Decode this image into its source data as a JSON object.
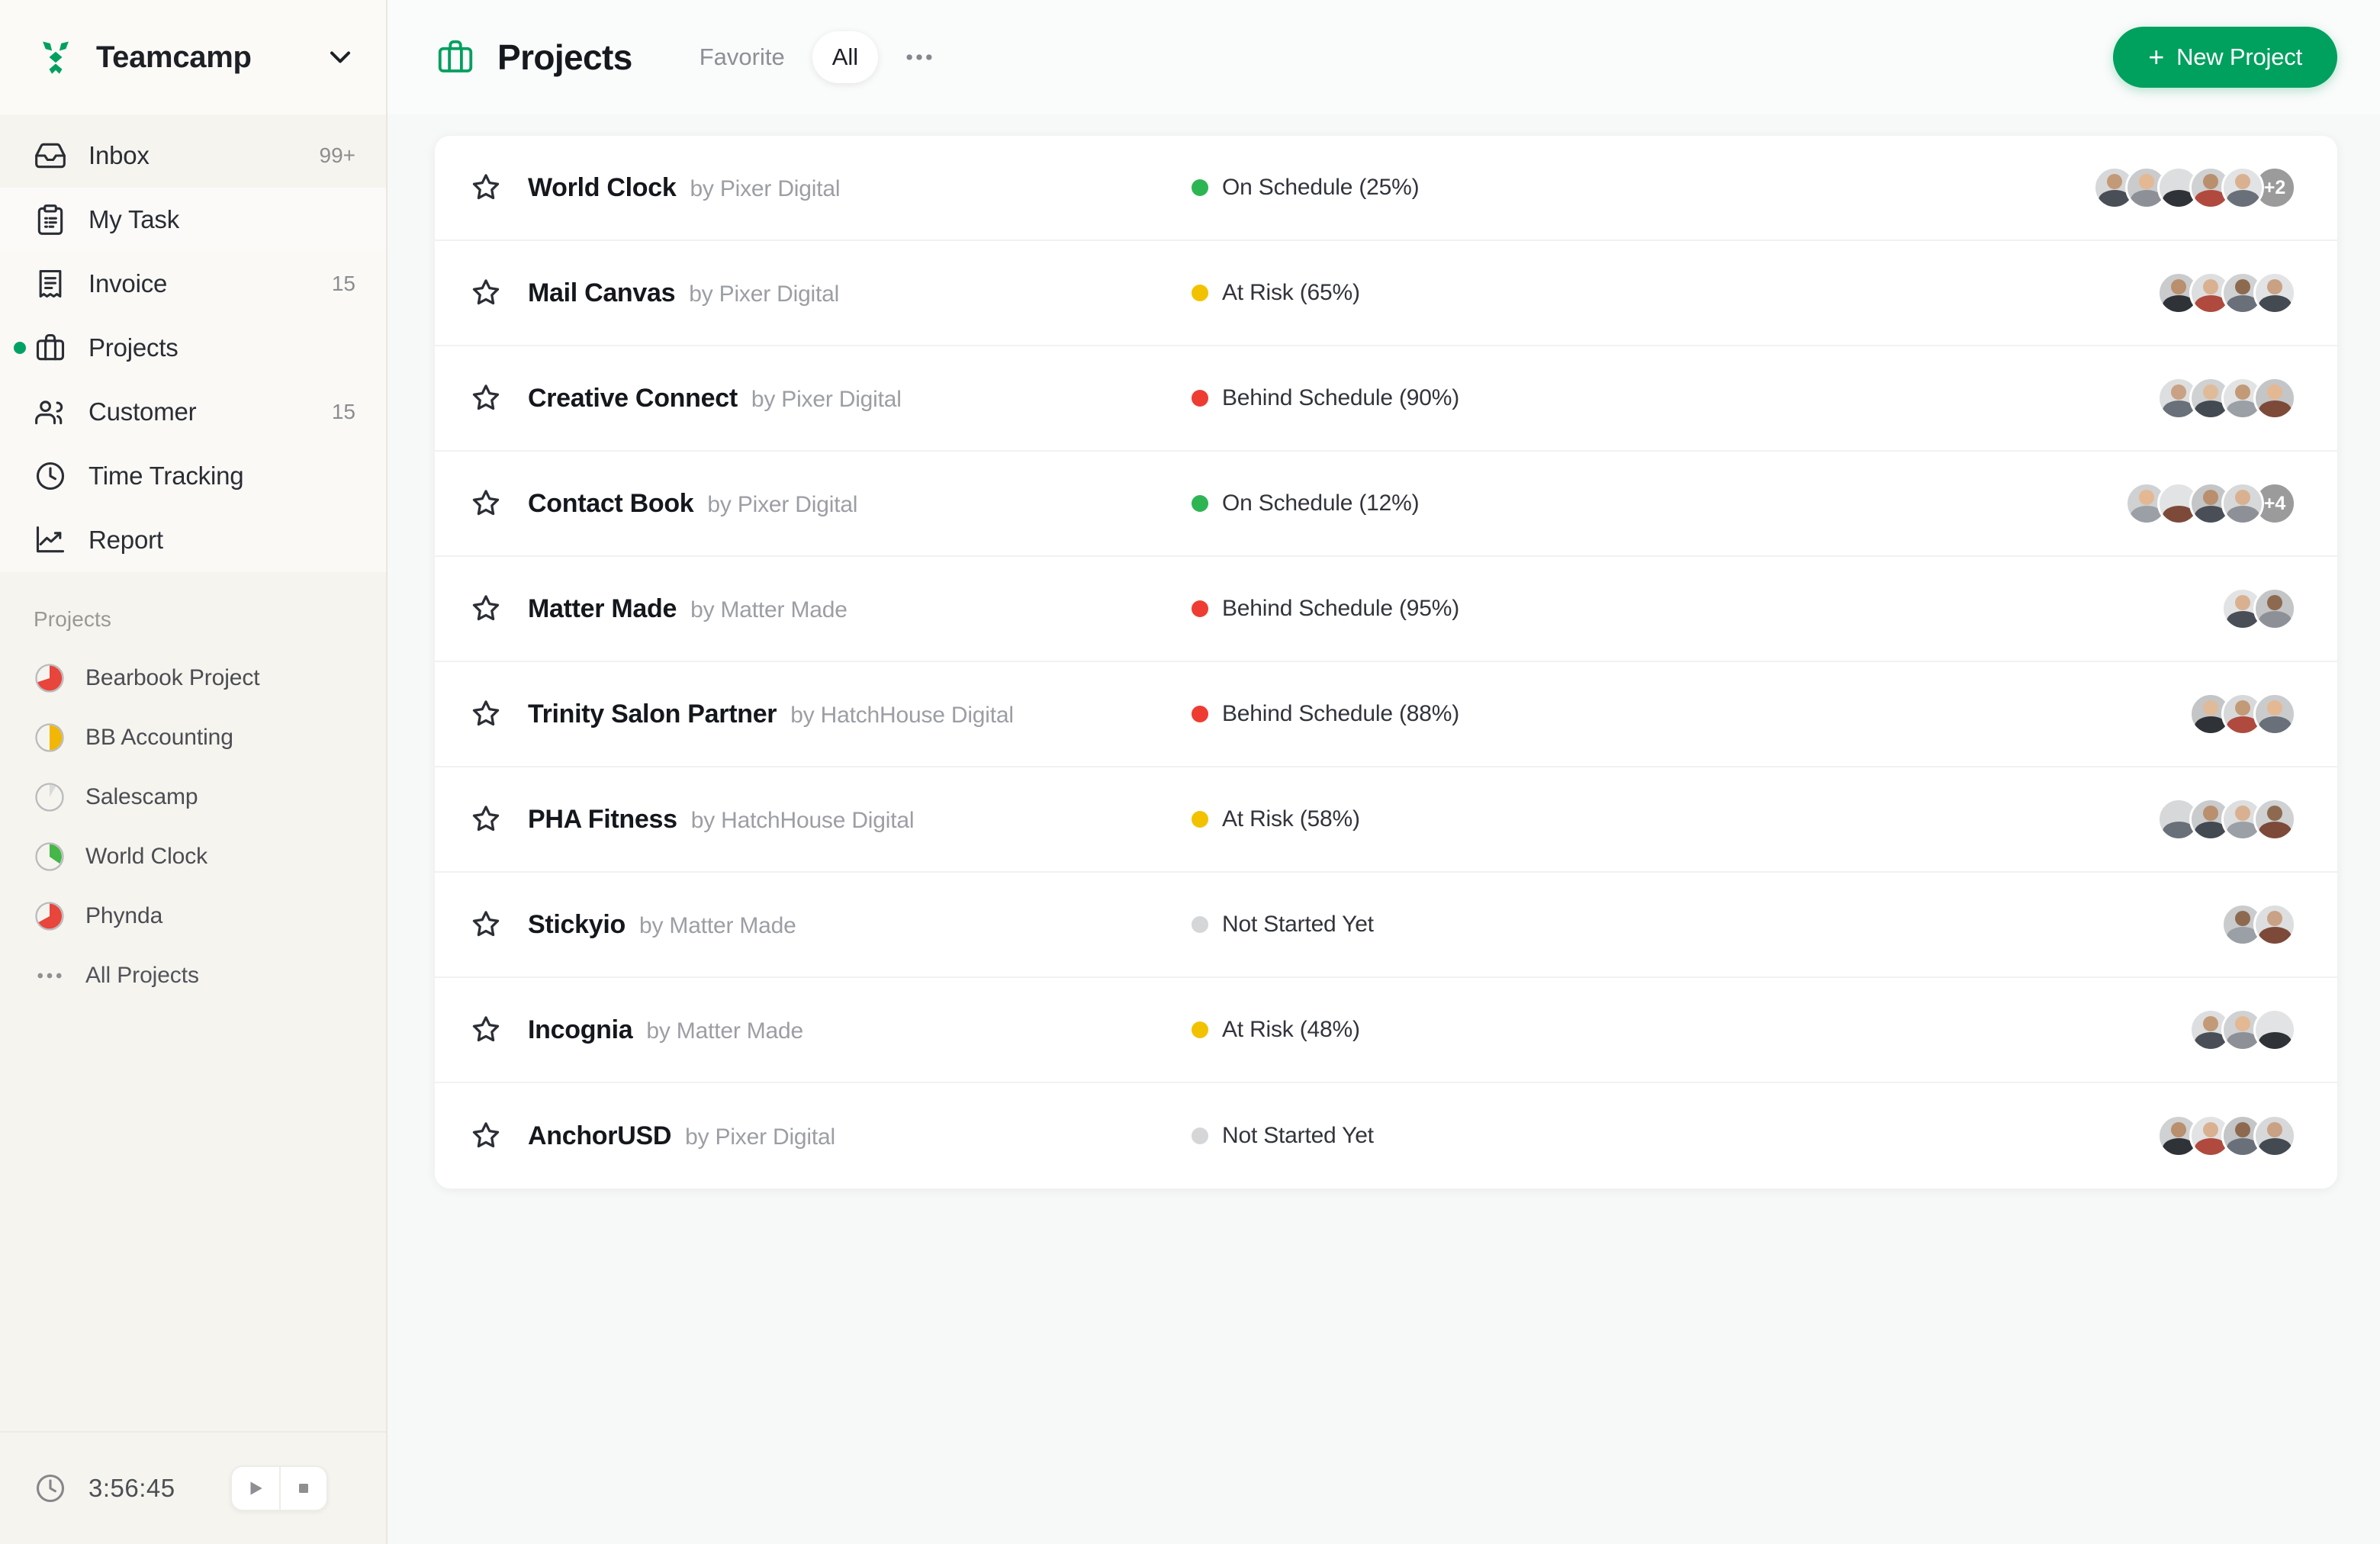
{
  "sidebar": {
    "brand": {
      "name": "Teamcamp",
      "logo_icon": "teamcamp-logo-icon",
      "chevron_icon": "chevron-down-icon"
    },
    "nav": [
      {
        "label": "Inbox",
        "icon": "inbox-icon",
        "badge": "99+",
        "active": false
      },
      {
        "label": "My Task",
        "icon": "clipboard-icon",
        "badge": "",
        "active": false
      },
      {
        "label": "Invoice",
        "icon": "invoice-icon",
        "badge": "15",
        "active": false
      },
      {
        "label": "Projects",
        "icon": "briefcase-icon",
        "badge": "",
        "active": true
      },
      {
        "label": "Customer",
        "icon": "users-icon",
        "badge": "15",
        "active": false
      },
      {
        "label": "Time Tracking",
        "icon": "clock-icon",
        "badge": "",
        "active": false
      },
      {
        "label": "Report",
        "icon": "chart-line-icon",
        "badge": "",
        "active": false
      }
    ],
    "projects_section_title": "Projects",
    "projects": [
      {
        "label": "Bearbook Project",
        "progress": 72,
        "color": "#e8453c"
      },
      {
        "label": "BB Accounting",
        "progress": 45,
        "color": "#f2b705"
      },
      {
        "label": "Salescamp",
        "progress": 8,
        "color": "#d9dad9"
      },
      {
        "label": "World Clock",
        "progress": 15,
        "color": "#45b648"
      },
      {
        "label": "Phynda",
        "progress": 70,
        "color": "#e8453c"
      }
    ],
    "all_projects_label": "All Projects",
    "all_projects_icon": "dots-horizontal-icon",
    "timer": {
      "clock_icon": "clock-icon",
      "elapsed": "3:56:45",
      "play_icon": "play-icon",
      "stop_icon": "stop-icon"
    }
  },
  "topbar": {
    "icon": "briefcase-icon",
    "title": "Projects",
    "tabs": [
      {
        "label": "Favorite",
        "active": false
      },
      {
        "label": "All",
        "active": true
      }
    ],
    "more_icon": "dots-horizontal-icon",
    "new_project_label": "New Project",
    "new_project_plus": "+"
  },
  "colors": {
    "accent": "#00a05f",
    "on_schedule": "#2eb553",
    "at_risk": "#f2c200",
    "behind_schedule": "#ef3c32",
    "not_started": "#d4d6d8",
    "sidebar_bg": "#f6f4ef",
    "main_bg": "#f7f8f8",
    "card_bg": "#ffffff"
  },
  "projects_list": [
    {
      "name": "World Clock",
      "by": "by Pixer Digital",
      "status": "On Schedule (25%)",
      "status_color": "#2eb553",
      "avatars": 5,
      "extra": "+2"
    },
    {
      "name": "Mail Canvas",
      "by": "by Pixer Digital",
      "status": "At Risk (65%)",
      "status_color": "#f2c200",
      "avatars": 4,
      "extra": ""
    },
    {
      "name": "Creative Connect",
      "by": "by Pixer Digital",
      "status": "Behind Schedule (90%)",
      "status_color": "#ef3c32",
      "avatars": 4,
      "extra": ""
    },
    {
      "name": "Contact Book",
      "by": "by Pixer Digital",
      "status": "On Schedule (12%)",
      "status_color": "#2eb553",
      "avatars": 4,
      "extra": "+4"
    },
    {
      "name": "Matter Made",
      "by": "by Matter Made",
      "status": "Behind Schedule (95%)",
      "status_color": "#ef3c32",
      "avatars": 2,
      "extra": ""
    },
    {
      "name": "Trinity Salon Partner",
      "by": "by HatchHouse Digital",
      "status": "Behind Schedule (88%)",
      "status_color": "#ef3c32",
      "avatars": 3,
      "extra": ""
    },
    {
      "name": "PHA Fitness",
      "by": "by HatchHouse Digital",
      "status": "At Risk (58%)",
      "status_color": "#f2c200",
      "avatars": 4,
      "extra": ""
    },
    {
      "name": "Stickyio",
      "by": "by Matter Made",
      "status": "Not Started Yet",
      "status_color": "#d4d6d8",
      "avatars": 2,
      "extra": ""
    },
    {
      "name": "Incognia",
      "by": "by Matter Made",
      "status": "At Risk (48%)",
      "status_color": "#f2c200",
      "avatars": 3,
      "extra": ""
    },
    {
      "name": "AnchorUSD",
      "by": "by Pixer Digital",
      "status": "Not Started Yet",
      "status_color": "#d4d6d8",
      "avatars": 4,
      "extra": ""
    }
  ],
  "star_icon": "star-outline-icon"
}
